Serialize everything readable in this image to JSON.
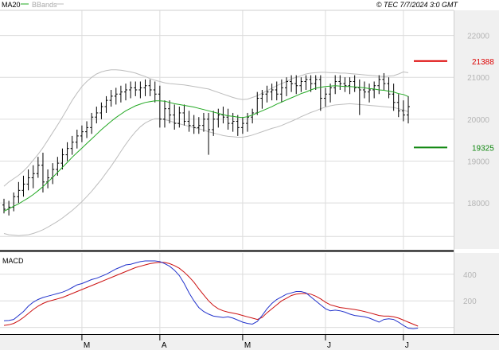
{
  "header": {
    "legend": [
      {
        "label": "MA20",
        "color": "#22a822"
      },
      {
        "label": "BBands",
        "color": "#bdbdbd"
      }
    ],
    "copyright": "© TEC 7/7/2024 3:0 GMT"
  },
  "colors": {
    "grid": "#dcdcdc",
    "ohlc": "#000000",
    "ma20": "#22a822",
    "bbands": "#bdbdbd",
    "resistance": "#dd0000",
    "support": "#118811",
    "macd": "#2233cc",
    "signal": "#cc1111",
    "gutter": "#f0f0f0",
    "divider": "#000000"
  },
  "chart_data": [
    {
      "type": "ohlc",
      "ylim": [
        16900,
        22600
      ],
      "yticks": [
        18000,
        19000,
        20000,
        21000,
        22000
      ],
      "ytick_labels": [
        "18000",
        "19000",
        "20000",
        "21000",
        "22000"
      ],
      "x_labels": [
        "M",
        "A",
        "M",
        "J",
        "J"
      ],
      "x_label_bar_index": [
        16,
        32,
        49,
        66,
        82
      ],
      "grid": true,
      "levels": [
        {
          "name": "resistance",
          "value": 21388,
          "label": "21388"
        },
        {
          "name": "support",
          "value": 19325,
          "label": "19325"
        }
      ],
      "series": [
        {
          "name": "MA20",
          "kind": "line",
          "values": [
            17800,
            17860,
            17920,
            17980,
            18050,
            18120,
            18200,
            18290,
            18390,
            18500,
            18610,
            18730,
            18850,
            18970,
            19090,
            19200,
            19310,
            19420,
            19530,
            19640,
            19750,
            19850,
            19950,
            20040,
            20120,
            20200,
            20260,
            20320,
            20360,
            20400,
            20420,
            20440,
            20440,
            20430,
            20400,
            20370,
            20350,
            20330,
            20310,
            20290,
            20260,
            20230,
            20200,
            20170,
            20140,
            20110,
            20080,
            20070,
            20050,
            20040,
            20060,
            20100,
            20150,
            20200,
            20250,
            20300,
            20360,
            20410,
            20460,
            20510,
            20560,
            20610,
            20650,
            20700,
            20740,
            20760,
            20780,
            20790,
            20800,
            20790,
            20780,
            20780,
            20770,
            20760,
            20750,
            20730,
            20720,
            20700,
            20690,
            20670,
            20650,
            20610,
            20590,
            20540
          ]
        },
        {
          "name": "BBands Upper",
          "kind": "line",
          "values": [
            18400,
            18500,
            18580,
            18660,
            18760,
            18880,
            19020,
            19160,
            19320,
            19500,
            19680,
            19860,
            20050,
            20250,
            20450,
            20620,
            20780,
            20900,
            21000,
            21080,
            21130,
            21160,
            21180,
            21180,
            21170,
            21150,
            21130,
            21100,
            21060,
            21020,
            20970,
            20930,
            20900,
            20870,
            20850,
            20840,
            20830,
            20820,
            20800,
            20780,
            20760,
            20740,
            20720,
            20680,
            20640,
            20600,
            20560,
            20520,
            20490,
            20470,
            20480,
            20520,
            20560,
            20620,
            20680,
            20740,
            20800,
            20850,
            20900,
            20960,
            21000,
            21040,
            21080,
            21100,
            21110,
            21120,
            21120,
            21110,
            21110,
            21100,
            21100,
            21090,
            21080,
            21070,
            21060,
            21050,
            21040,
            21030,
            21020,
            21030,
            21040,
            21080,
            21130,
            21110
          ]
        },
        {
          "name": "BBands Lower",
          "kind": "line",
          "values": [
            17270,
            17240,
            17230,
            17220,
            17230,
            17240,
            17270,
            17310,
            17360,
            17420,
            17490,
            17560,
            17640,
            17730,
            17820,
            17920,
            18030,
            18150,
            18280,
            18420,
            18560,
            18720,
            18880,
            19050,
            19230,
            19400,
            19560,
            19700,
            19820,
            19910,
            19970,
            20010,
            20010,
            19990,
            19960,
            19920,
            19890,
            19860,
            19830,
            19800,
            19770,
            19740,
            19700,
            19670,
            19640,
            19610,
            19590,
            19580,
            19570,
            19570,
            19590,
            19620,
            19660,
            19700,
            19740,
            19780,
            19810,
            19850,
            19900,
            19950,
            20000,
            20060,
            20110,
            20160,
            20200,
            20250,
            20290,
            20320,
            20340,
            20350,
            20360,
            20370,
            20360,
            20350,
            20340,
            20330,
            20320,
            20310,
            20300,
            20290,
            20280,
            20250,
            20220,
            20180
          ]
        },
        {
          "name": "OHLC",
          "kind": "ohlc",
          "values": [
            [
              17950,
              18100,
              17750,
              17850
            ],
            [
              17850,
              18050,
              17700,
              17900
            ],
            [
              17900,
              18250,
              17800,
              18150
            ],
            [
              18150,
              18500,
              18000,
              18300
            ],
            [
              18300,
              18650,
              18150,
              18450
            ],
            [
              18450,
              18800,
              18300,
              18600
            ],
            [
              18600,
              18900,
              18350,
              18700
            ],
            [
              18700,
              19100,
              18600,
              18900
            ],
            [
              18900,
              19200,
              18250,
              18500
            ],
            [
              18500,
              18800,
              18350,
              18600
            ],
            [
              18600,
              18950,
              18450,
              18800
            ],
            [
              18800,
              19100,
              18650,
              18950
            ],
            [
              18950,
              19300,
              18800,
              19150
            ],
            [
              19150,
              19450,
              19000,
              19300
            ],
            [
              19300,
              19600,
              19150,
              19450
            ],
            [
              19450,
              19750,
              19300,
              19600
            ],
            [
              19600,
              19850,
              19450,
              19700
            ],
            [
              19700,
              19950,
              19550,
              19800
            ],
            [
              19800,
              20150,
              19650,
              20050
            ],
            [
              20050,
              20300,
              19900,
              20150
            ],
            [
              20150,
              20400,
              20000,
              20300
            ],
            [
              20300,
              20550,
              20150,
              20450
            ],
            [
              20450,
              20700,
              20300,
              20550
            ],
            [
              20550,
              20750,
              20350,
              20600
            ],
            [
              20600,
              20800,
              20400,
              20650
            ],
            [
              20650,
              20850,
              20450,
              20700
            ],
            [
              20700,
              20900,
              20500,
              20750
            ],
            [
              20750,
              20900,
              20550,
              20700
            ],
            [
              20700,
              20900,
              20500,
              20750
            ],
            [
              20750,
              20950,
              20550,
              20800
            ],
            [
              20800,
              20950,
              20550,
              20700
            ],
            [
              20700,
              20900,
              20400,
              20600
            ],
            [
              20600,
              20800,
              19800,
              20000
            ],
            [
              20000,
              20450,
              19800,
              20250
            ],
            [
              20250,
              20450,
              19900,
              20100
            ],
            [
              20100,
              20350,
              19750,
              19900
            ],
            [
              19900,
              20300,
              19800,
              20150
            ],
            [
              20150,
              20350,
              19850,
              19950
            ],
            [
              19950,
              20200,
              19700,
              19850
            ],
            [
              19850,
              20100,
              19650,
              19800
            ],
            [
              19800,
              20050,
              19650,
              19850
            ],
            [
              19850,
              20150,
              19700,
              20000
            ],
            [
              20000,
              20150,
              19150,
              19750
            ],
            [
              19750,
              20200,
              19600,
              20000
            ],
            [
              20000,
              20250,
              19800,
              20100
            ],
            [
              20100,
              20300,
              19900,
              20050
            ],
            [
              20050,
              20250,
              19750,
              19900
            ],
            [
              19900,
              20150,
              19700,
              19950
            ],
            [
              19950,
              20100,
              19600,
              19800
            ],
            [
              19800,
              20050,
              19650,
              19900
            ],
            [
              19900,
              20150,
              19700,
              20050
            ],
            [
              20050,
              20250,
              19900,
              20150
            ],
            [
              20150,
              20650,
              20100,
              20500
            ],
            [
              20500,
              20700,
              20250,
              20600
            ],
            [
              20600,
              20800,
              20400,
              20650
            ],
            [
              20650,
              20850,
              20450,
              20700
            ],
            [
              20700,
              20900,
              20450,
              20600
            ],
            [
              20600,
              20950,
              20400,
              20750
            ],
            [
              20750,
              21000,
              20550,
              20900
            ],
            [
              20900,
              21050,
              20650,
              20850
            ],
            [
              20850,
              21050,
              20600,
              20800
            ],
            [
              20800,
              21000,
              20650,
              20900
            ],
            [
              20900,
              21050,
              20700,
              20950
            ],
            [
              20950,
              21050,
              20650,
              20850
            ],
            [
              20850,
              21050,
              20700,
              20950
            ],
            [
              20950,
              21050,
              20200,
              20500
            ],
            [
              20500,
              20750,
              20300,
              20600
            ],
            [
              20600,
              20850,
              20400,
              20750
            ],
            [
              20750,
              21050,
              20600,
              20900
            ],
            [
              20900,
              21050,
              20700,
              20850
            ],
            [
              20850,
              21000,
              20650,
              20800
            ],
            [
              20800,
              21000,
              20600,
              20900
            ],
            [
              20900,
              21050,
              20650,
              20750
            ],
            [
              20750,
              20950,
              20100,
              20700
            ],
            [
              20700,
              20900,
              20500,
              20650
            ],
            [
              20650,
              20850,
              20400,
              20700
            ],
            [
              20700,
              20900,
              20500,
              20800
            ],
            [
              20800,
              21050,
              20600,
              20950
            ],
            [
              20950,
              21100,
              20700,
              20850
            ],
            [
              20850,
              21000,
              20500,
              20600
            ],
            [
              20600,
              20850,
              20200,
              20400
            ],
            [
              20400,
              20600,
              20050,
              20200
            ],
            [
              20200,
              20450,
              19950,
              20100
            ],
            [
              20100,
              20550,
              19900,
              20300
            ]
          ]
        }
      ]
    },
    {
      "type": "line",
      "title": "MACD",
      "ylim": [
        -50,
        560
      ],
      "yticks": [
        200,
        400
      ],
      "ytick_labels": [
        "200",
        "400"
      ],
      "grid": true,
      "series": [
        {
          "name": "MACD",
          "values": [
            50,
            52,
            60,
            90,
            120,
            160,
            190,
            210,
            225,
            235,
            245,
            255,
            265,
            280,
            300,
            320,
            330,
            345,
            360,
            370,
            385,
            400,
            420,
            440,
            455,
            470,
            475,
            485,
            495,
            500,
            500,
            500,
            495,
            480,
            460,
            430,
            390,
            330,
            260,
            200,
            150,
            120,
            100,
            85,
            80,
            75,
            80,
            70,
            55,
            40,
            30,
            25,
            45,
            90,
            140,
            180,
            210,
            230,
            250,
            260,
            270,
            270,
            260,
            230,
            200,
            170,
            140,
            125,
            130,
            125,
            115,
            100,
            90,
            85,
            80,
            70,
            55,
            40,
            60,
            65,
            60,
            40,
            15,
            -5,
            -10,
            -5
          ]
        },
        {
          "name": "Signal",
          "values": [
            15,
            20,
            30,
            50,
            75,
            105,
            135,
            160,
            180,
            195,
            205,
            215,
            225,
            240,
            255,
            270,
            285,
            300,
            315,
            330,
            345,
            360,
            375,
            390,
            405,
            420,
            435,
            450,
            460,
            470,
            480,
            485,
            490,
            488,
            480,
            465,
            445,
            415,
            380,
            340,
            290,
            245,
            200,
            165,
            140,
            125,
            115,
            108,
            100,
            90,
            80,
            70,
            60,
            75,
            110,
            140,
            170,
            200,
            220,
            240,
            250,
            255,
            255,
            250,
            235,
            215,
            190,
            170,
            160,
            150,
            145,
            140,
            135,
            128,
            120,
            110,
            100,
            90,
            85,
            85,
            80,
            70,
            55,
            40,
            25,
            10
          ]
        }
      ]
    }
  ]
}
